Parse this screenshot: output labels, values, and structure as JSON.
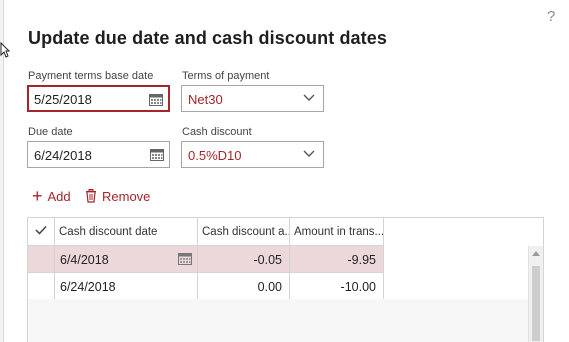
{
  "dialog": {
    "title": "Update due date and cash discount dates",
    "help_icon": "?"
  },
  "fields": {
    "payment_terms_base_date": {
      "label": "Payment terms base date",
      "value": "5/25/2018",
      "icon": "calendar-icon"
    },
    "terms_of_payment": {
      "label": "Terms of payment",
      "value": "Net30",
      "icon": "chevron-down-icon"
    },
    "due_date": {
      "label": "Due date",
      "value": "6/24/2018",
      "icon": "calendar-icon"
    },
    "cash_discount": {
      "label": "Cash discount",
      "value": "0.5%D10",
      "icon": "chevron-down-icon"
    }
  },
  "actions": {
    "add_label": "Add",
    "add_icon": "+",
    "remove_label": "Remove",
    "remove_icon": "trash-icon"
  },
  "grid": {
    "columns": [
      "Cash discount date",
      "Cash discount a...",
      "Amount in trans..."
    ],
    "select_all_icon": "checkmark-icon",
    "rows": [
      {
        "date": "6/4/2018",
        "discount": "-0.05",
        "amount": "-9.95",
        "selected": true
      },
      {
        "date": "6/24/2018",
        "discount": "0.00",
        "amount": "-10.00",
        "selected": false
      }
    ]
  },
  "colors": {
    "accent": "#a4262c",
    "selected_row": "#ecd8db"
  }
}
